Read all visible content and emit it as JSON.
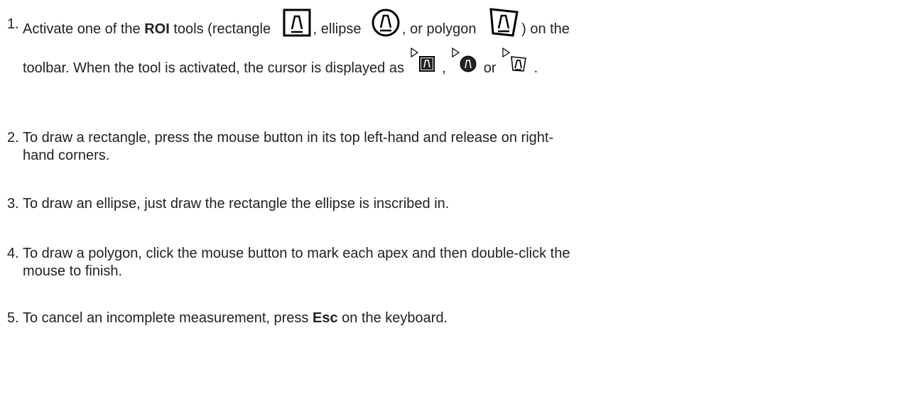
{
  "steps": [
    {
      "number": "1.",
      "line1": {
        "a": "Activate one of the ",
        "b_bold": "ROI",
        "c": " tools (rectangle ",
        "d": ", ellipse ",
        "e": ", or polygon ",
        "f": ") on the"
      },
      "line2": {
        "a": "toolbar. When the tool is activated, the cursor is displayed as ",
        "b": " , ",
        "c": " or ",
        "d": " ."
      }
    },
    {
      "number": "2.",
      "line1": "To draw a rectangle, press the mouse button in its top left-hand and release on right-",
      "line2": "hand corners."
    },
    {
      "number": "3.",
      "line1": "To draw an ellipse, just draw the rectangle the ellipse is inscribed in."
    },
    {
      "number": "4.",
      "line1": "To draw a polygon, click the mouse button to mark each apex and then double-click the",
      "line2": "mouse to finish."
    },
    {
      "number": "5.",
      "text_before": "To cancel an incomplete measurement, press ",
      "bold": "Esc",
      "text_after": " on the keyboard."
    }
  ],
  "icons": {
    "rectangle_tool": "roi-rectangle-icon",
    "ellipse_tool": "roi-ellipse-icon",
    "polygon_tool": "roi-polygon-icon",
    "cursor_rectangle": "cursor-rectangle-icon",
    "cursor_ellipse": "cursor-ellipse-icon",
    "cursor_polygon": "cursor-polygon-icon"
  }
}
